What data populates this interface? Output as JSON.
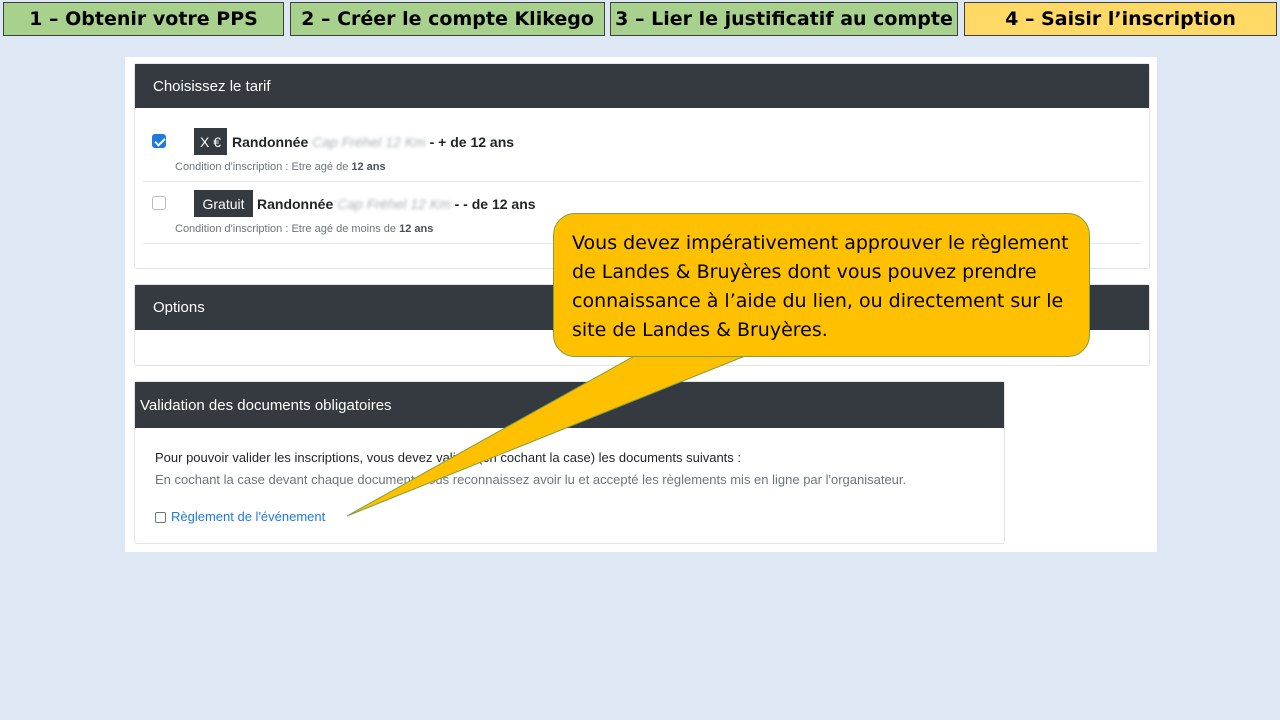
{
  "steps": [
    {
      "label": "1 – Obtenir votre PPS",
      "state": "done"
    },
    {
      "label": "2 – Créer le compte Klikego",
      "state": "done"
    },
    {
      "label": "3 – Lier le justificatif au compte",
      "state": "done"
    },
    {
      "label": "4 – Saisir l’inscription",
      "state": "active"
    }
  ],
  "tarif": {
    "header": "Choisissez le tarif",
    "rows": [
      {
        "checked": true,
        "price": "X €",
        "name_prefix": "Randonnée",
        "name_blurred": "Cap Fréhel 12 Km",
        "name_suffix": "- + de 12 ans",
        "condition_prefix": "Condition d'inscription : Etre agé de",
        "condition_value": "12 ans"
      },
      {
        "checked": false,
        "price": "Gratuit",
        "name_prefix": "Randonnée",
        "name_blurred": "Cap Fréhel 12 Km",
        "name_suffix": "- - de 12 ans",
        "condition_prefix": "Condition d'inscription : Etre agé de moins de",
        "condition_value": "12 ans"
      }
    ]
  },
  "options": {
    "header": "Options"
  },
  "validation": {
    "header": "Validation des documents obligatoires",
    "line1": "Pour pouvoir valider les inscriptions, vous devez valider (en cochant la case) les documents suivants :",
    "line2": "En cochant la case devant chaque document, vous reconnaissez avoir lu et accepté les règlements mis en ligne par l'organisateur.",
    "link_label": "Règlement de l'événement"
  },
  "callout": {
    "text": "Vous devez impérativement approuver le règlement de Landes & Bruyères dont vous pouvez prendre connaissance à l’aide du lien, ou directement sur le site de Landes & Bruyères."
  },
  "colors": {
    "step_done": "#a9d18e",
    "step_active": "#ffd966",
    "card_header": "#343a40",
    "checkbox_checked": "#1f7ae0",
    "link": "#1f7ae0",
    "callout": "#ffc000",
    "background": "#dde8f4"
  }
}
